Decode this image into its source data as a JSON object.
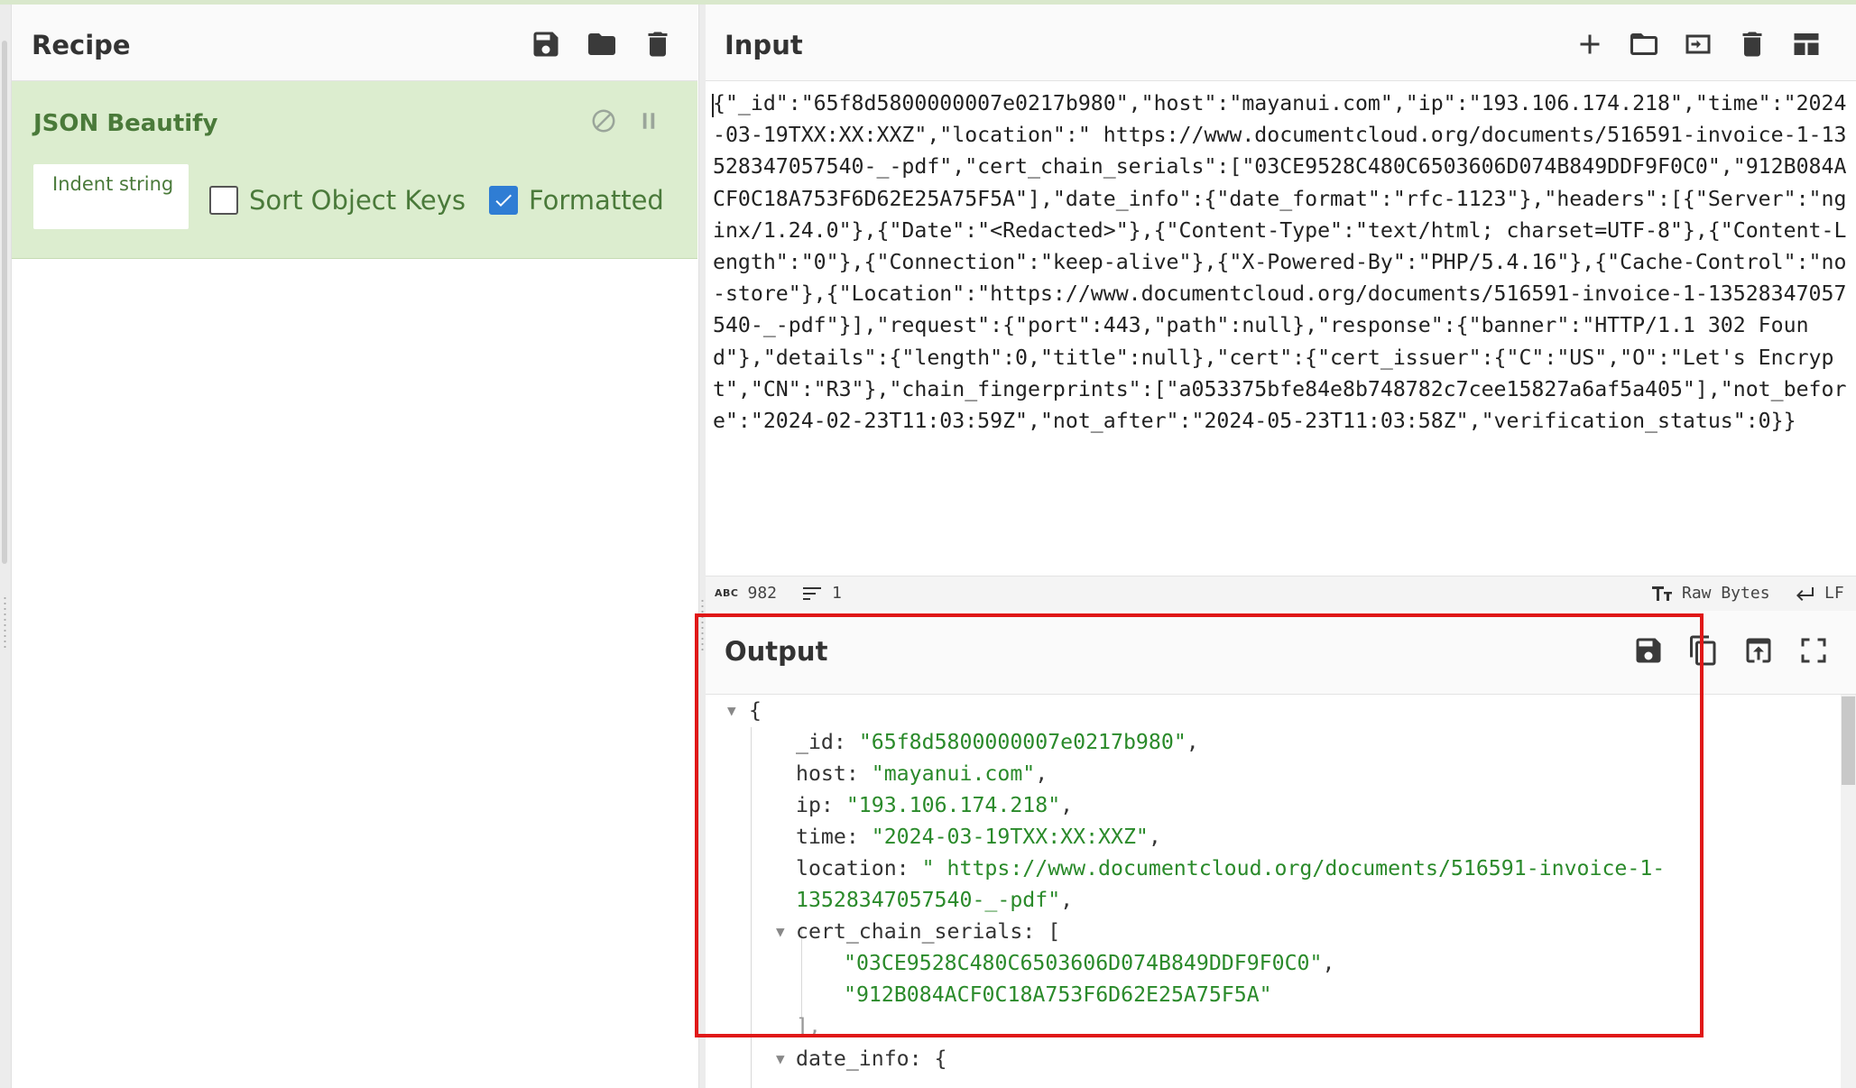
{
  "recipe": {
    "title": "Recipe",
    "icons": [
      "save-icon",
      "folder-icon",
      "trash-icon"
    ],
    "operation": {
      "name": "JSON Beautify",
      "indent_label": "Indent string",
      "sort_keys_label": "Sort Object Keys",
      "sort_keys_checked": false,
      "formatted_label": "Formatted",
      "formatted_checked": true
    }
  },
  "input": {
    "title": "Input",
    "icons": [
      "plus-icon",
      "folder-icon",
      "import-icon",
      "trash-icon",
      "layout-icon"
    ],
    "text": "{\"_id\":\"65f8d5800000007e0217b980\",\"host\":\"mayanui.com\",\"ip\":\"193.106.174.218\",\"time\":\"2024-03-19TXX:XX:XXZ\",\"location\":\" https://www.documentcloud.org/documents/516591-invoice-1-13528347057540-_-pdf\",\"cert_chain_serials\":[\"03CE9528C480C6503606D074B849DDF9F0C0\",\"912B084ACF0C18A753F6D62E25A75F5A\"],\"date_info\":{\"date_format\":\"rfc-1123\"},\"headers\":[{\"Server\":\"nginx/1.24.0\"},{\"Date\":\"<Redacted>\"},{\"Content-Type\":\"text/html; charset=UTF-8\"},{\"Content-Length\":\"0\"},{\"Connection\":\"keep-alive\"},{\"X-Powered-By\":\"PHP/5.4.16\"},{\"Cache-Control\":\"no-store\"},{\"Location\":\"https://www.documentcloud.org/documents/516591-invoice-1-13528347057540-_-pdf\"}],\"request\":{\"port\":443,\"path\":null},\"response\":{\"banner\":\"HTTP/1.1 302 Found\"},\"details\":{\"length\":0,\"title\":null},\"cert\":{\"cert_issuer\":{\"C\":\"US\",\"O\":\"Let's Encrypt\",\"CN\":\"R3\"},\"chain_fingerprints\":[\"a053375bfe84e8b748782c7cee15827a6af5a405\"],\"not_before\":\"2024-02-23T11:03:59Z\",\"not_after\":\"2024-05-23T11:03:58Z\",\"verification_status\":0}}"
  },
  "status": {
    "abc_label": "ABC",
    "char_count": "982",
    "line_count": "1",
    "encoding": "Raw Bytes",
    "eol": "LF"
  },
  "output": {
    "title": "Output",
    "icons": [
      "save-icon",
      "copy-icon",
      "replace-input-icon",
      "maximise-icon"
    ],
    "lines": {
      "open_brace": "{",
      "id_key": "_id: ",
      "id_val": "\"65f8d5800000007e0217b980\"",
      "host_key": "host: ",
      "host_val": "\"mayanui.com\"",
      "ip_key": "ip: ",
      "ip_val": "\"193.106.174.218\"",
      "time_key": "time: ",
      "time_val": "\"2024-03-19TXX:XX:XXZ\"",
      "location_key": "location: ",
      "location_val_1": "\" https://www.documentcloud.org/documents/516591-invoice-1-",
      "location_val_2": "13528347057540-_-pdf\"",
      "serials_key": "cert_chain_serials: [",
      "serial_1": "\"03CE9528C480C6503606D074B849DDF9F0C0\"",
      "serial_2": "\"912B084ACF0C18A753F6D62E25A75F5A\"",
      "serials_close": "],",
      "date_info_key": "date_info: {",
      "comma": ","
    }
  },
  "colors": {
    "operation_bg": "#dcedcf",
    "operation_text": "#4a7a3a",
    "checkbox_on": "#2f7dd4",
    "json_string": "#2a8a2a",
    "highlight": "#e01818"
  }
}
